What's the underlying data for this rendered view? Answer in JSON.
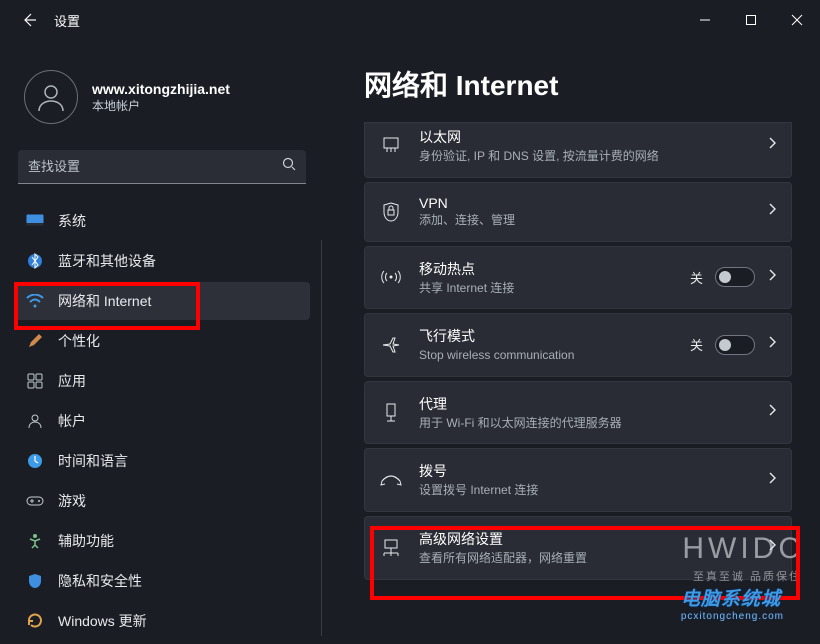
{
  "titlebar": {
    "title": "设置"
  },
  "user": {
    "name": "www.xitongzhijia.net",
    "sub": "本地帐户"
  },
  "search": {
    "placeholder": "查找设置"
  },
  "sidebar": {
    "items": [
      {
        "label": "系统"
      },
      {
        "label": "蓝牙和其他设备"
      },
      {
        "label": "网络和 Internet"
      },
      {
        "label": "个性化"
      },
      {
        "label": "应用"
      },
      {
        "label": "帐户"
      },
      {
        "label": "时间和语言"
      },
      {
        "label": "游戏"
      },
      {
        "label": "辅助功能"
      },
      {
        "label": "隐私和安全性"
      },
      {
        "label": "Windows 更新"
      }
    ]
  },
  "main": {
    "title": "网络和 Internet",
    "cards": [
      {
        "title": "以太网",
        "sub": "身份验证, IP 和 DNS 设置, 按流量计费的网络"
      },
      {
        "title": "VPN",
        "sub": "添加、连接、管理"
      },
      {
        "title": "移动热点",
        "sub": "共享 Internet 连接",
        "toggle": true,
        "toggle_label": "关"
      },
      {
        "title": "飞行模式",
        "sub": "Stop wireless communication",
        "toggle": true,
        "toggle_label": "关"
      },
      {
        "title": "代理",
        "sub": "用于 Wi-Fi 和以太网连接的代理服务器"
      },
      {
        "title": "拨号",
        "sub": "设置拨号 Internet 连接"
      },
      {
        "title": "高级网络设置",
        "sub": "查看所有网络适配器，网络重置"
      }
    ]
  },
  "watermarks": {
    "brand": "HWIDC",
    "tagline": "至真至诚 品质保住",
    "site": "电脑系统城",
    "site_sub": "pcxitongcheng.com"
  }
}
